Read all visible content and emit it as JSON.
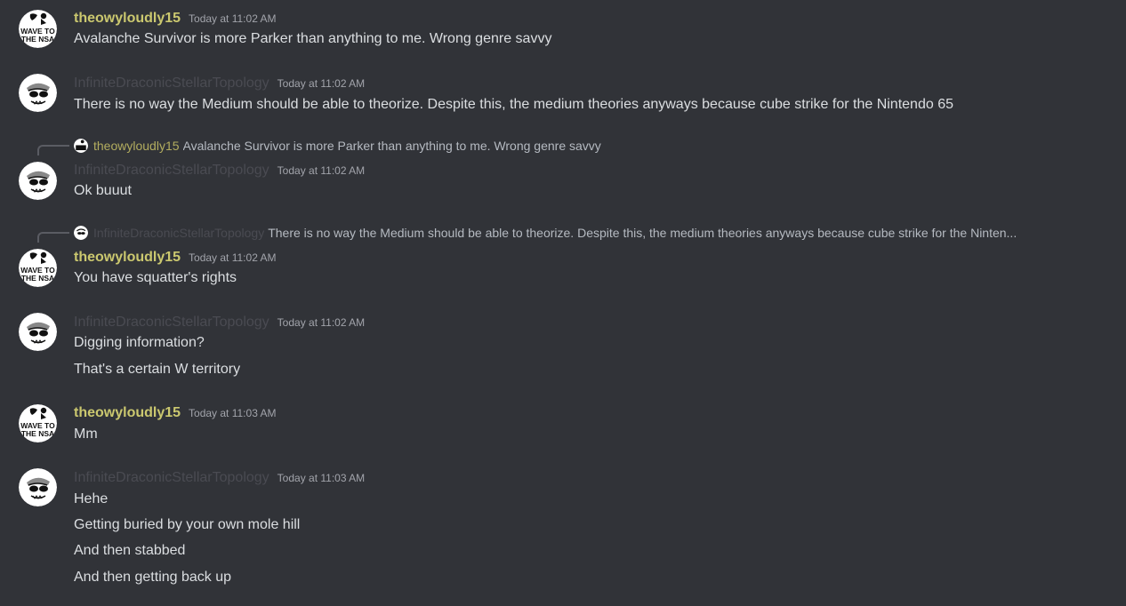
{
  "messages": [
    {
      "author": "theowyloudly15",
      "timestamp": "Today at 11:02 AM",
      "lines": [
        "Avalanche Survivor is more Parker than anything to me. Wrong genre savvy"
      ]
    },
    {
      "author": "InfiniteDraconicStellarTopology",
      "timestamp": "Today at 11:02 AM",
      "lines": [
        "There is no way the Medium should be able to theorize. Despite this, the medium theories anyways because cube strike for the Nintendo 65"
      ]
    },
    {
      "reply": {
        "author": "theowyloudly15",
        "text": "Avalanche Survivor is more Parker than anything to me. Wrong genre savvy"
      },
      "author": "InfiniteDraconicStellarTopology",
      "timestamp": "Today at 11:02 AM",
      "lines": [
        "Ok buuut"
      ]
    },
    {
      "reply": {
        "author": "InfiniteDraconicStellarTopology",
        "text": "There is no way the Medium should be able to theorize. Despite this, the medium theories anyways because cube strike for the Ninten..."
      },
      "author": "theowyloudly15",
      "timestamp": "Today at 11:02 AM",
      "lines": [
        "You have squatter's rights"
      ]
    },
    {
      "author": "InfiniteDraconicStellarTopology",
      "timestamp": "Today at 11:02 AM",
      "lines": [
        "Digging information?",
        "That's a certain W territory"
      ]
    },
    {
      "author": "theowyloudly15",
      "timestamp": "Today at 11:03 AM",
      "lines": [
        "Mm"
      ]
    },
    {
      "author": "InfiniteDraconicStellarTopology",
      "timestamp": "Today at 11:03 AM",
      "lines": [
        "Hehe",
        "Getting buried by your own mole hill",
        "And then stabbed",
        "And then getting back up"
      ]
    }
  ],
  "avatar_text": {
    "theowyloudly15": [
      "WAVE TO",
      "THE NSA"
    ]
  },
  "colors": {
    "background": "#313338",
    "theo_name": "#cbc86f",
    "inf_name": "#4a4b52",
    "text": "#dbdee1",
    "timestamp": "#a2a4ab"
  }
}
